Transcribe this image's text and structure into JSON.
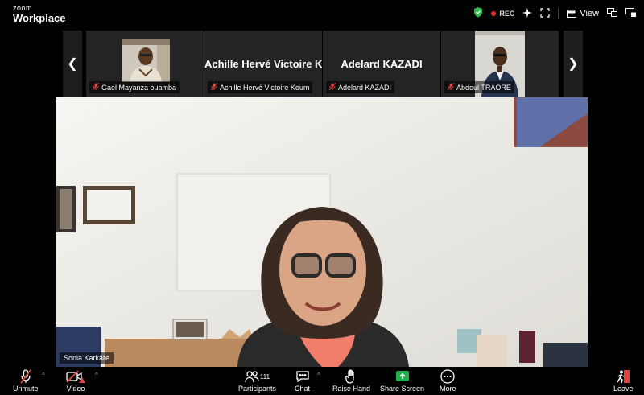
{
  "app": {
    "brand_small": "zoom",
    "brand_big": "Workplace"
  },
  "topbar": {
    "rec_label": "REC",
    "view_label": "View"
  },
  "thumbnails": [
    {
      "name_label": "Gael Mayanza ouamba",
      "big_name": ""
    },
    {
      "name_label": "Achille Hervé Victoire Koum",
      "big_name": "Achille Hervé Victoire K..."
    },
    {
      "name_label": "Adelard KAZADI",
      "big_name": "Adelard KAZADI"
    },
    {
      "name_label": "Abdoul TRAORE",
      "big_name": ""
    }
  ],
  "main": {
    "speaker_label": "Sonia Karkare"
  },
  "controls": {
    "unmute": "Unmute",
    "video": "Video",
    "participants": "Participants",
    "participants_count": "111",
    "chat": "Chat",
    "raise_hand": "Raise Hand",
    "share_screen": "Share Screen",
    "more": "More",
    "leave": "Leave"
  },
  "colors": {
    "rec": "#e02f2f",
    "share": "#23b14d",
    "shield": "#2fbf4a",
    "muted": "#e0453b"
  }
}
